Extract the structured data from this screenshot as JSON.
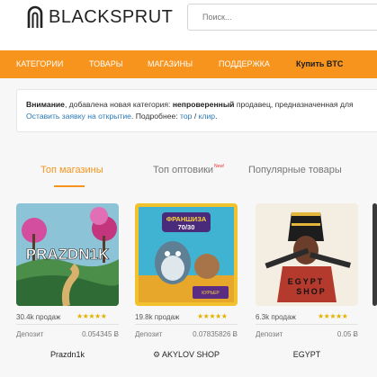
{
  "header": {
    "logo_text": "BLACKSPRUT",
    "search_placeholder": "Поиск..."
  },
  "nav": {
    "items": [
      "КАТЕГОРИИ",
      "ТОВАРЫ",
      "МАГАЗИНЫ",
      "ПОДДЕРЖКА"
    ],
    "buy_btc": "Купить BTC"
  },
  "notice": {
    "label": "Внимание",
    "text_1": ", добавлена новая категория: ",
    "category": "непроверенный",
    "text_2": " продавец, предназначенная для",
    "link_apply": "Оставить заявку на открытие",
    "text_3": ". Подробнее: ",
    "link_tor": "тор",
    "slash": " / ",
    "link_clear": "клир",
    "dot": "."
  },
  "tabs": {
    "top_shops": "Топ магазины",
    "top_wholesalers": "Топ оптовики",
    "new_badge": "New!",
    "popular": "Популярные товары"
  },
  "cards": [
    {
      "name": "Prazdn1k",
      "image_text": "PRAZDN1K",
      "sales": "30.4k продаж",
      "stars": "★★★★★",
      "deposit_label": "Депозит",
      "deposit": "0.054345 Ƀ"
    },
    {
      "name": "AKYLOV SHOP",
      "image_text": "ФРАНШИЗА 70/30",
      "sales": "19.8k продаж",
      "stars": "★★★★★",
      "deposit_label": "Депозит",
      "deposit": "0.07835826 Ƀ"
    },
    {
      "name": "EGYPT",
      "image_text": "EGYPT SHOP",
      "sales": "6.3k продаж",
      "stars": "★★★★★",
      "deposit_label": "Депозит",
      "deposit": "0.05 Ƀ"
    }
  ],
  "colors": {
    "accent": "#f7941d",
    "link": "#2a7ab8",
    "star": "#e3b100"
  }
}
